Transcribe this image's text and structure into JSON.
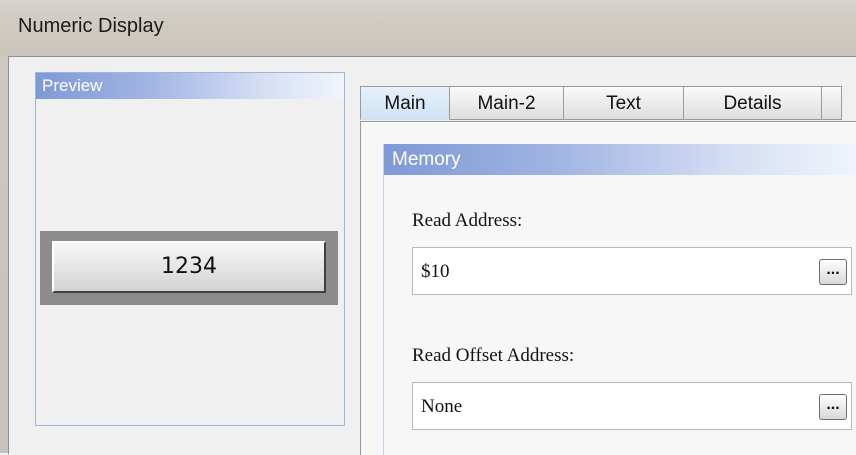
{
  "window": {
    "title": "Numeric Display"
  },
  "preview": {
    "header": "Preview",
    "display_value": "1234"
  },
  "tabs": [
    {
      "label": "Main",
      "active": true
    },
    {
      "label": "Main-2",
      "active": false
    },
    {
      "label": "Text",
      "active": false
    },
    {
      "label": "Details",
      "active": false
    }
  ],
  "memory": {
    "header": "Memory",
    "read_address": {
      "label": "Read Address:",
      "value": "$10",
      "browse_label": "..."
    },
    "read_offset_address": {
      "label": "Read Offset Address:",
      "value": "None",
      "browse_label": "..."
    }
  }
}
